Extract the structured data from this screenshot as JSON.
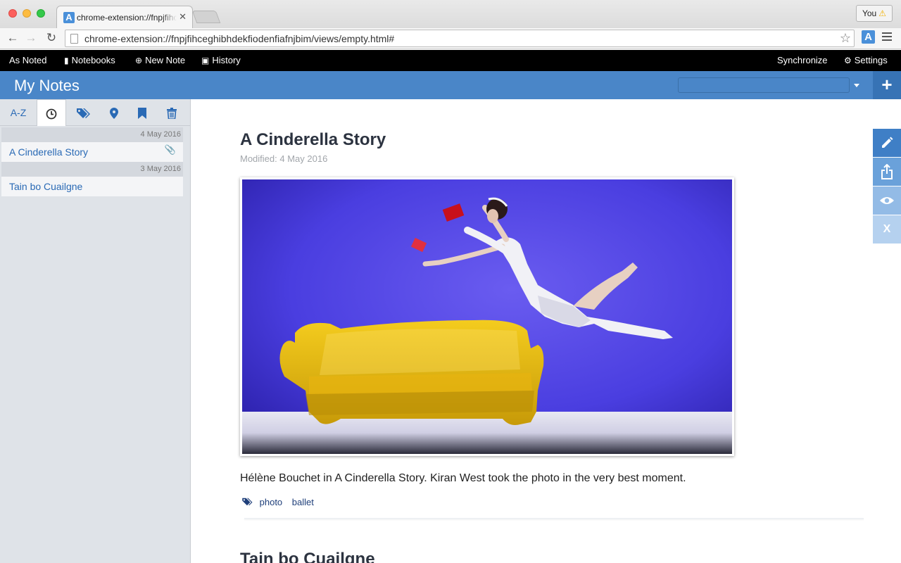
{
  "browser": {
    "tab_title": "chrome-extension://fnpjfihc",
    "tab_close": "✕",
    "url": "chrome-extension://fnpjfihceghibhdekfiodenfiafnjbim/views/empty.html#",
    "profile_label": "You",
    "profile_warning": "⚠"
  },
  "appnav": {
    "brand": "As Noted",
    "notebooks": "Notebooks",
    "new_note": "New Note",
    "history": "History",
    "synchronize": "Synchronize",
    "settings": "Settings"
  },
  "header": {
    "title": "My Notes",
    "add_label": "+"
  },
  "sidebar": {
    "sort_az": "A-Z",
    "groups": [
      {
        "date": "4 May 2016",
        "notes": [
          {
            "title": "A Cinderella Story",
            "has_attachment": true
          }
        ]
      },
      {
        "date": "3 May 2016",
        "notes": [
          {
            "title": "Tain bo Cuailgne",
            "has_attachment": false
          }
        ]
      }
    ]
  },
  "main": {
    "notes": [
      {
        "title": "A Cinderella Story",
        "modified": "Modified: 4 May 2016",
        "body": "Hélène Bouchet in A Cinderella Story. Kiran West took the photo in the very best moment.",
        "tags": [
          "photo",
          "ballet"
        ]
      },
      {
        "title": "Tain bo Cuailgne"
      }
    ]
  },
  "actions": {
    "close_label": "X",
    "icons": [
      "pencil-icon",
      "share-icon",
      "eye-icon"
    ]
  },
  "colors": {
    "header_blue": "#4a86c8",
    "link_blue": "#2a6ab5",
    "nav_black": "#000000"
  }
}
